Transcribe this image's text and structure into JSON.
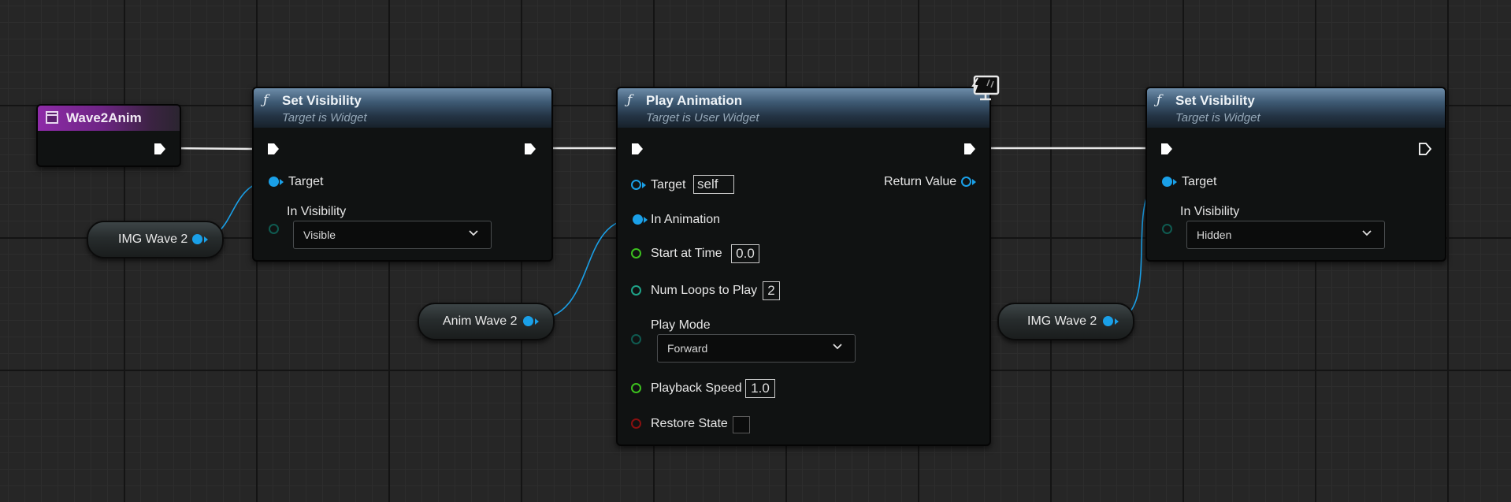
{
  "nodes": {
    "event": {
      "title": "Wave2Anim"
    },
    "set_visibility_1": {
      "title": "Set Visibility",
      "subtitle": "Target is Widget",
      "pins": {
        "target": "Target",
        "in_visibility": "In Visibility"
      },
      "in_visibility_value": "Visible"
    },
    "play_animation": {
      "title": "Play Animation",
      "subtitle": "Target is User Widget",
      "pins": {
        "target": "Target",
        "target_default": "self",
        "in_animation": "In Animation",
        "start_at_time": "Start at Time",
        "start_at_time_value": "0.0",
        "num_loops": "Num Loops to Play",
        "num_loops_value": "2",
        "play_mode": "Play Mode",
        "play_mode_value": "Forward",
        "playback_speed": "Playback Speed",
        "playback_speed_value": "1.0",
        "restore_state": "Restore State",
        "return_value": "Return Value"
      }
    },
    "set_visibility_2": {
      "title": "Set Visibility",
      "subtitle": "Target is Widget",
      "pins": {
        "target": "Target",
        "in_visibility": "In Visibility"
      },
      "in_visibility_value": "Hidden"
    }
  },
  "variables": {
    "img_wave_left": "IMG Wave 2",
    "anim_wave": "Anim Wave 2",
    "img_wave_right": "IMG Wave 2"
  },
  "icons": {
    "function": "function-icon",
    "event": "widget-event-icon",
    "client_only": "monitor-icon",
    "exec": "exec-pin-icon",
    "dropdown": "chevron-down-icon"
  },
  "colors": {
    "object_pin": "#1aa0e8",
    "float_pin": "#3cc01e",
    "int_pin": "#1fa388",
    "bool_pin": "#8a1010",
    "event_header": "#8e2ba8"
  }
}
